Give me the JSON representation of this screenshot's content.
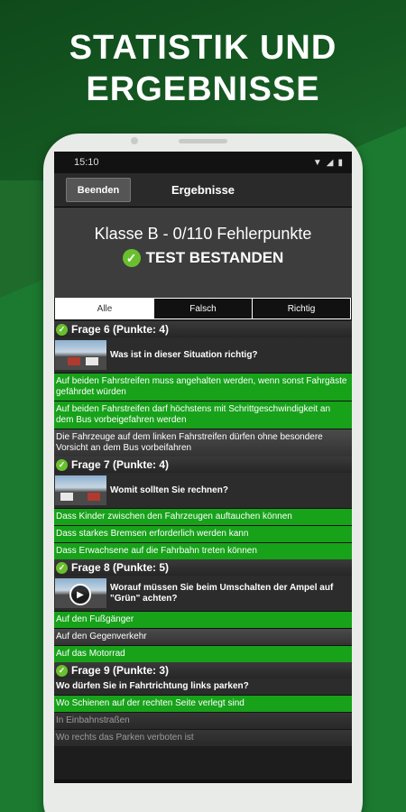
{
  "headline": {
    "line1": "STATISTIK UND",
    "line2": "ERGEBNISSE"
  },
  "status": {
    "time": "15:10"
  },
  "appbar": {
    "back_label": "Beenden",
    "title": "Ergebnisse"
  },
  "summary": {
    "score": "Klasse B - 0/110 Fehlerpunkte",
    "result": "TEST BESTANDEN"
  },
  "tabs": [
    "Alle",
    "Falsch",
    "Richtig"
  ],
  "questions": [
    {
      "header": "Frage 6 (Punkte: 4)",
      "text": "Was ist in dieser Situation richtig?",
      "answers": [
        "Auf beiden Fahrstreifen muss angehalten werden, wenn sonst Fahrgäste gefährdet würden",
        "Auf beiden Fahrstreifen darf höchstens mit Schrittgeschwindigkeit an dem Bus vorbeigefahren werden",
        "Die Fahrzeuge auf dem linken Fahrstreifen dürfen ohne besondere Vorsicht an dem Bus vorbeifahren"
      ]
    },
    {
      "header": "Frage 7 (Punkte: 4)",
      "text": "Womit sollten Sie rechnen?",
      "answers": [
        "Dass Kinder zwischen den Fahrzeugen auftauchen können",
        "Dass starkes Bremsen erforderlich werden kann",
        "Dass Erwachsene auf die Fahrbahn treten können"
      ]
    },
    {
      "header": "Frage 8 (Punkte: 5)",
      "text": "Worauf müssen Sie beim Umschalten der Ampel auf \"Grün\" achten?",
      "answers": [
        "Auf den Fußgänger",
        "Auf den Gegenverkehr",
        "Auf das Motorrad"
      ]
    },
    {
      "header": "Frage 9 (Punkte: 3)",
      "text": "Wo dürfen Sie in Fahrtrichtung links parken?",
      "answers": [
        "Wo Schienen auf der rechten Seite verlegt sind",
        "In Einbahnstraßen",
        "Wo rechts das Parken verboten ist"
      ]
    }
  ],
  "colors": {
    "correct": "#17a21a",
    "check": "#6abf2e",
    "background": "#1c7a30"
  }
}
